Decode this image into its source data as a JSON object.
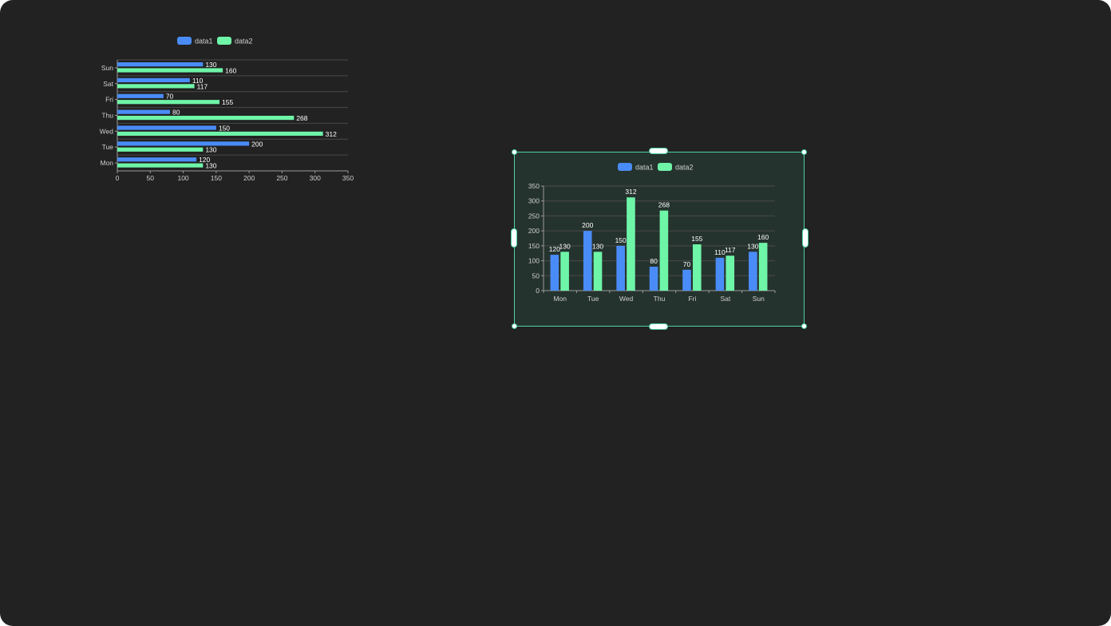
{
  "colors": {
    "canvas_bg": "#222222",
    "selection_border": "#4fd1a5",
    "selected_bg": "#25332e",
    "series1": "#4a8cf7",
    "series2": "#6ef5a8",
    "axis_text": "#cfcfcf",
    "value_text": "#ffffff",
    "grid": "#4a4a4a"
  },
  "chart_data": [
    {
      "type": "bar",
      "orientation": "horizontal",
      "categories": [
        "Mon",
        "Tue",
        "Wed",
        "Thu",
        "Fri",
        "Sat",
        "Sun"
      ],
      "series": [
        {
          "name": "data1",
          "values": [
            120,
            200,
            150,
            80,
            70,
            110,
            130
          ]
        },
        {
          "name": "data2",
          "values": [
            130,
            130,
            312,
            268,
            155,
            117,
            160
          ]
        }
      ],
      "xlim": [
        0,
        350
      ],
      "ticks": [
        "0",
        "50",
        "100",
        "150",
        "200",
        "250",
        "300",
        "350"
      ],
      "legend": "top-center",
      "data_labels": true,
      "grid": true,
      "selected": false
    },
    {
      "type": "bar",
      "orientation": "vertical",
      "categories": [
        "Mon",
        "Tue",
        "Wed",
        "Thu",
        "Fri",
        "Sat",
        "Sun"
      ],
      "series": [
        {
          "name": "data1",
          "values": [
            120,
            200,
            150,
            80,
            70,
            110,
            130
          ]
        },
        {
          "name": "data2",
          "values": [
            130,
            130,
            312,
            268,
            155,
            117,
            160
          ]
        }
      ],
      "ylim": [
        0,
        350
      ],
      "ticks": [
        "0",
        "50",
        "100",
        "150",
        "200",
        "250",
        "300",
        "350"
      ],
      "legend": "top-center",
      "data_labels": true,
      "grid": true,
      "selected": true
    }
  ]
}
